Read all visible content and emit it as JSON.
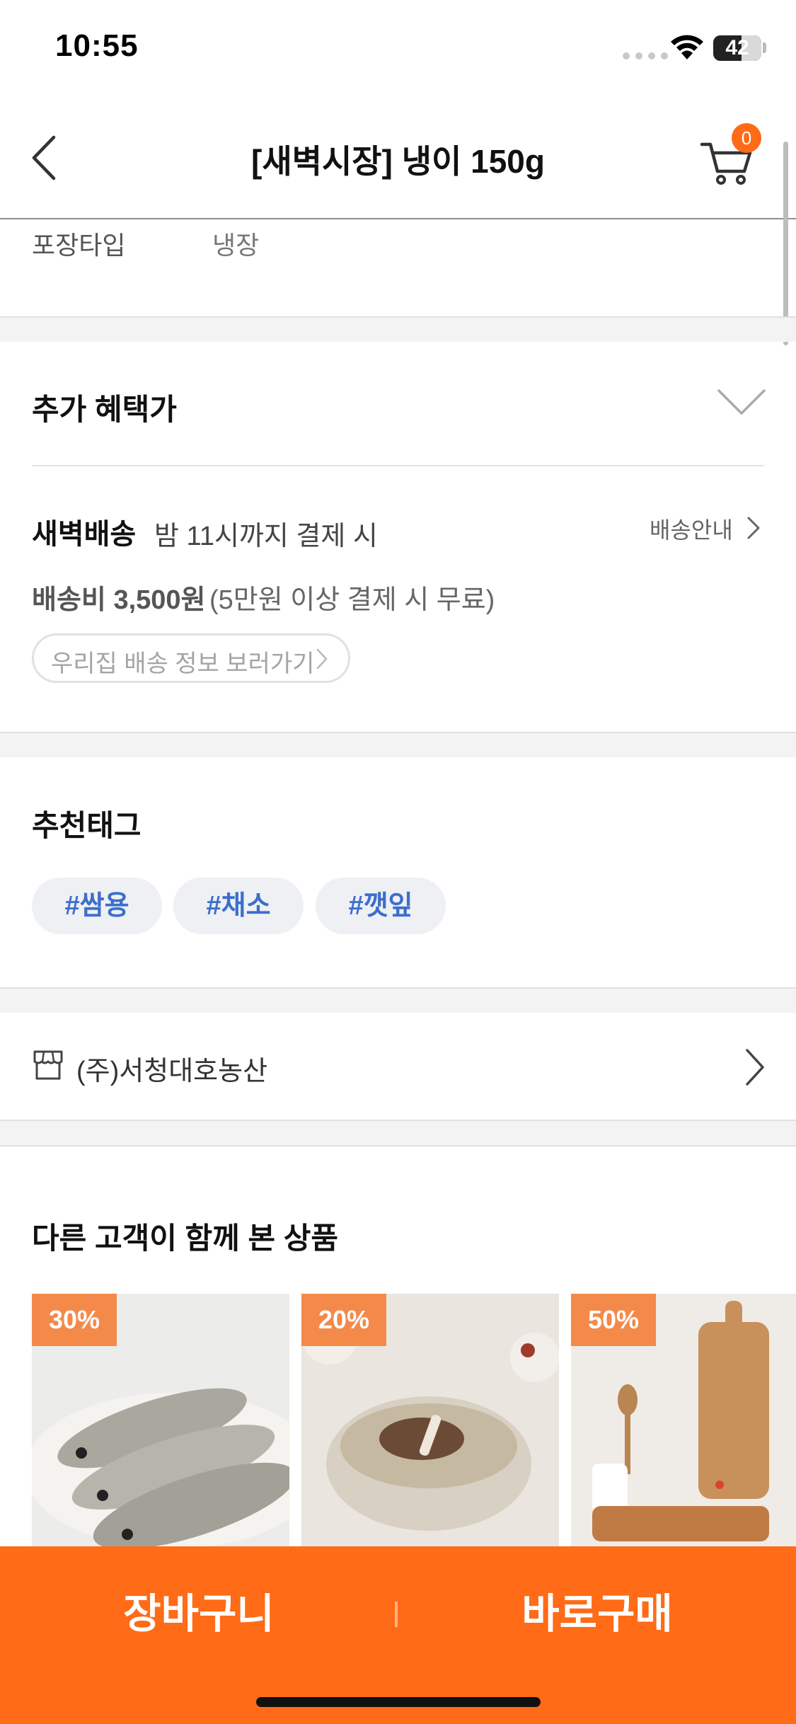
{
  "status_bar": {
    "time": "10:55",
    "battery": "42"
  },
  "header": {
    "title": "[새벽시장] 냉이 150g",
    "cart_count": "0"
  },
  "packaging": {
    "label": "포장타입",
    "value": "냉장"
  },
  "benefit": {
    "title": "추가 혜택가"
  },
  "shipping": {
    "main": "새벽배송",
    "sub": "밤 11시까지 결제 시",
    "guide_link": "배송안내",
    "fee_label": "배송비 3,500원",
    "fee_note": "(5만원 이상 결제 시 무료)",
    "info_button": "우리집 배송 정보 보러가기"
  },
  "tags": {
    "title": "추천태그",
    "items": [
      "#쌈용",
      "#채소",
      "#깻잎"
    ]
  },
  "seller": {
    "name": "(주)서청대호농산"
  },
  "recommend": {
    "title": "다른 고객이 함께 본 상품",
    "cards": [
      {
        "discount": "30%",
        "image": "fish-image"
      },
      {
        "discount": "20%",
        "image": "galbitang-image"
      },
      {
        "discount": "50%",
        "image": "cutting-board-image"
      }
    ]
  },
  "bottom_bar": {
    "cart_button": "장바구니",
    "buy_button": "바로구매"
  },
  "colors": {
    "accent": "#ff6b17",
    "tag_text": "#3c6ecc",
    "badge": "#f38a4a"
  }
}
